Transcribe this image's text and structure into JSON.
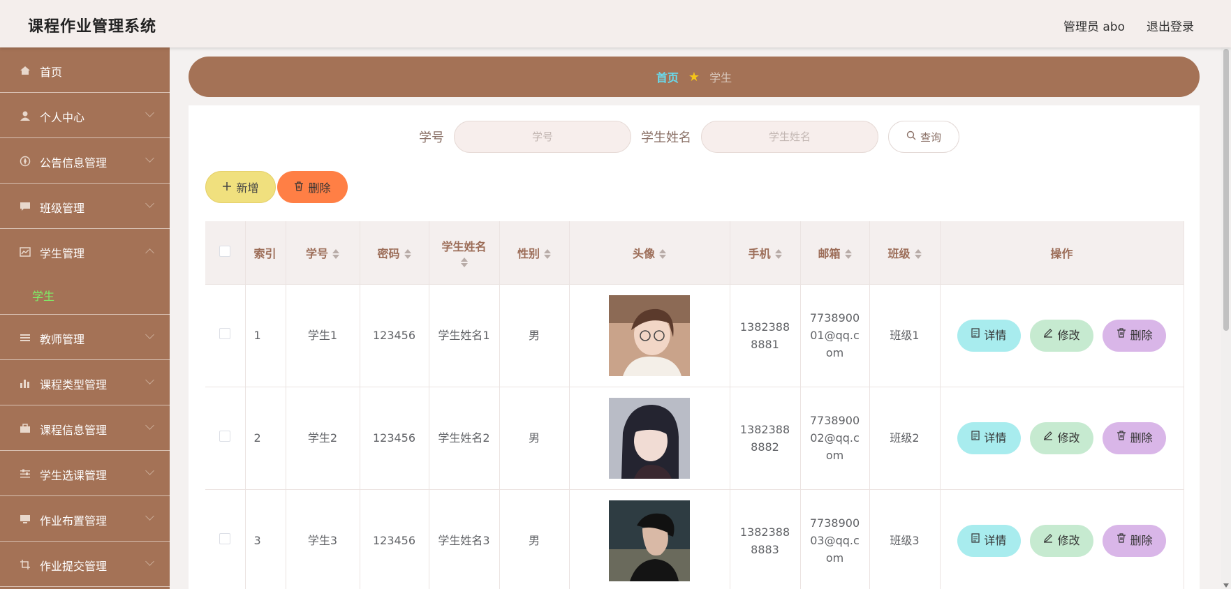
{
  "header": {
    "title": "课程作业管理系统",
    "user": "管理员 abo",
    "logout": "退出登录"
  },
  "sidebar": {
    "items": [
      {
        "label": "首页",
        "icon": "home-icon"
      },
      {
        "label": "个人中心",
        "icon": "user-icon"
      },
      {
        "label": "公告信息管理",
        "icon": "compass-icon"
      },
      {
        "label": "班级管理",
        "icon": "chat-icon"
      },
      {
        "label": "学生管理",
        "icon": "chart-icon"
      },
      {
        "label": "学生",
        "icon": ""
      },
      {
        "label": "教师管理",
        "icon": "list-icon"
      },
      {
        "label": "课程类型管理",
        "icon": "bar-chart-icon"
      },
      {
        "label": "课程信息管理",
        "icon": "briefcase-icon"
      },
      {
        "label": "学生选课管理",
        "icon": "sliders-icon"
      },
      {
        "label": "作业布置管理",
        "icon": "monitor-icon"
      },
      {
        "label": "作业提交管理",
        "icon": "crop-icon"
      }
    ]
  },
  "breadcrumb": {
    "home": "首页",
    "current": "学生"
  },
  "search": {
    "student_no_label": "学号",
    "student_no_placeholder": "学号",
    "student_name_label": "学生姓名",
    "student_name_placeholder": "学生姓名",
    "search_button": "查询"
  },
  "actions": {
    "add": "新增",
    "delete": "删除"
  },
  "table": {
    "headers": [
      "索引",
      "学号",
      "密码",
      "学生姓名",
      "性别",
      "头像",
      "手机",
      "邮箱",
      "班级",
      "操作"
    ],
    "rows": [
      {
        "index": "1",
        "student_no": "学生1",
        "password": "123456",
        "name": "学生姓名1",
        "gender": "男",
        "phone": "13823888881",
        "email": "773890001@qq.com",
        "class": "班级1"
      },
      {
        "index": "2",
        "student_no": "学生2",
        "password": "123456",
        "name": "学生姓名2",
        "gender": "男",
        "phone": "13823888882",
        "email": "773890002@qq.com",
        "class": "班级2"
      },
      {
        "index": "3",
        "student_no": "学生3",
        "password": "123456",
        "name": "学生姓名3",
        "gender": "男",
        "phone": "13823888883",
        "email": "773890003@qq.com",
        "class": "班级3"
      }
    ],
    "row_buttons": {
      "detail": "详情",
      "edit": "修改",
      "delete": "删除"
    }
  },
  "colors": {
    "sidebar_bg": "#a47256",
    "breadcrumb_home": "#68dcef",
    "active_submenu": "#7ef068",
    "add_button": "#f0e07e",
    "delete_button": "#ff7f45",
    "detail_button": "#a8ecee",
    "edit_button": "#c6ead0",
    "remove_button": "#d9b6e8"
  }
}
